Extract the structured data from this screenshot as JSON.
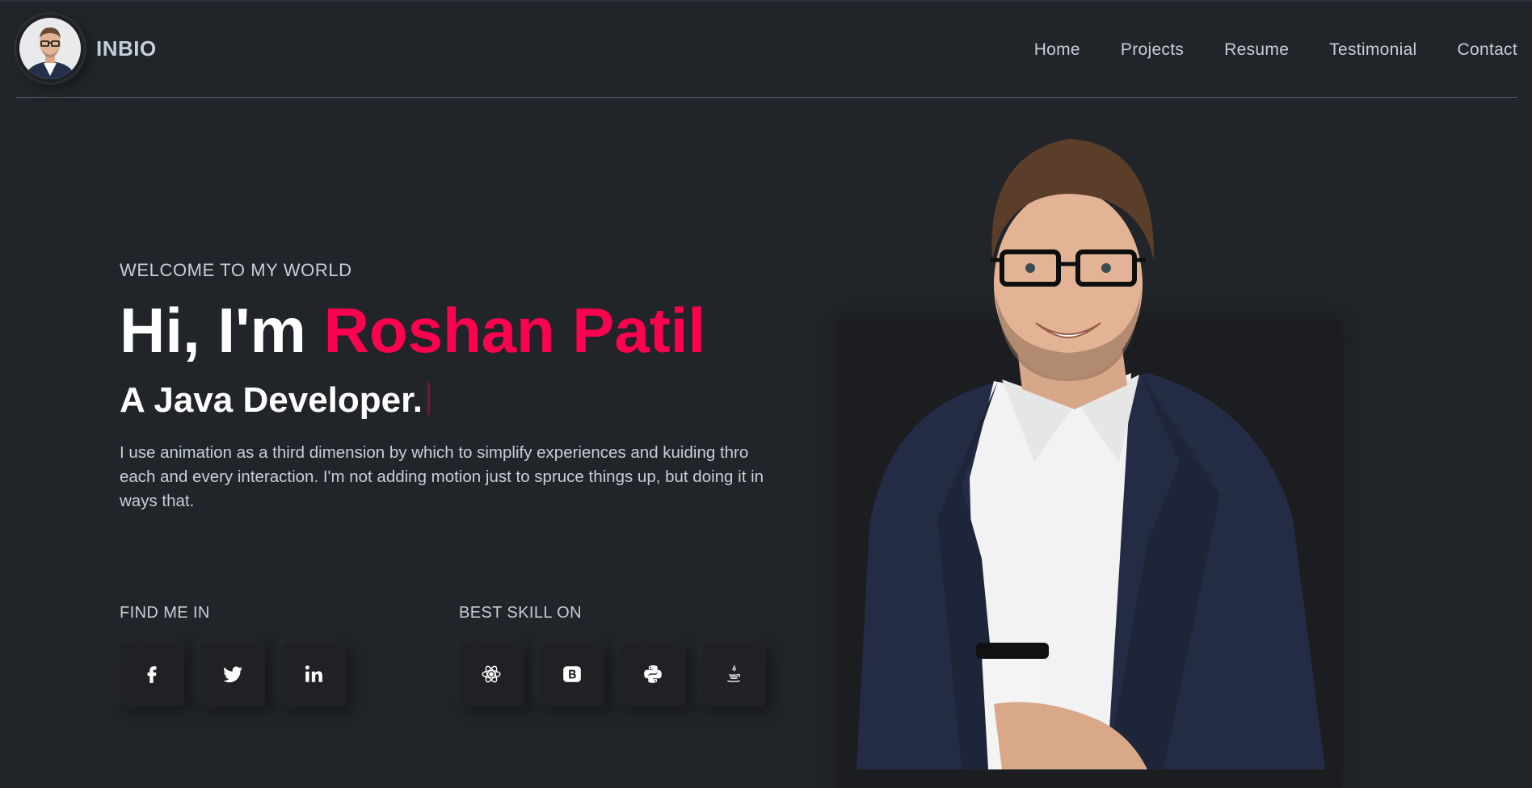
{
  "brand": {
    "name": "INBIO",
    "avatar_icon": "profile-avatar-icon"
  },
  "nav": {
    "items": [
      "Home",
      "Projects",
      "Resume",
      "Testimonial",
      "Contact"
    ]
  },
  "hero": {
    "welcome": "WELCOME TO MY WORLD",
    "greeting": "Hi, I'm",
    "name": "Roshan Patil",
    "role": "A Java Developer.",
    "description": "I use animation as a third dimension by which to simplify experiences and kuiding thro each and every interaction. I'm not adding motion just to spruce things up, but doing it in ways that."
  },
  "social": {
    "label": "FIND ME IN",
    "icons": [
      "facebook-icon",
      "twitter-icon",
      "linkedin-icon"
    ]
  },
  "skills": {
    "label": "BEST SKILL ON",
    "icons": [
      "react-icon",
      "bootstrap-icon",
      "python-icon",
      "java-icon"
    ]
  },
  "colors": {
    "accent": "#ff014f",
    "background": "#212428",
    "text": "#c4cfde",
    "heading": "#ffffff"
  }
}
